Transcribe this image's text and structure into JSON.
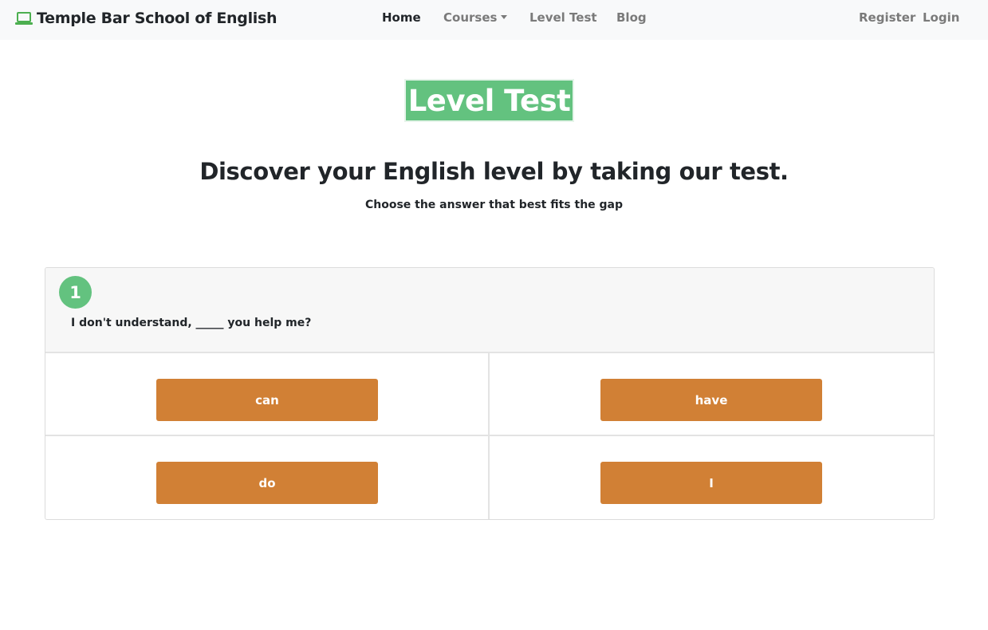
{
  "navbar": {
    "brand": "Temple Bar School of English",
    "brand_icon": "laptop-icon",
    "brand_icon_color": "#4caf50",
    "links": {
      "home": "Home",
      "courses": "Courses",
      "level_test": "Level Test",
      "blog": "Blog",
      "register": "Register",
      "login": "Login"
    }
  },
  "page": {
    "title": "Level Test",
    "headline": "Discover your English level by taking our test.",
    "instruction": "Choose the answer that best fits the gap"
  },
  "question": {
    "number": "1",
    "text": "I don't understand, _____ you help me?",
    "answers": [
      "can",
      "have",
      "do",
      "I"
    ]
  },
  "colors": {
    "accent_green": "#63c27f",
    "answer_button": "#d18035",
    "navbar_bg": "#f8f9fa"
  }
}
